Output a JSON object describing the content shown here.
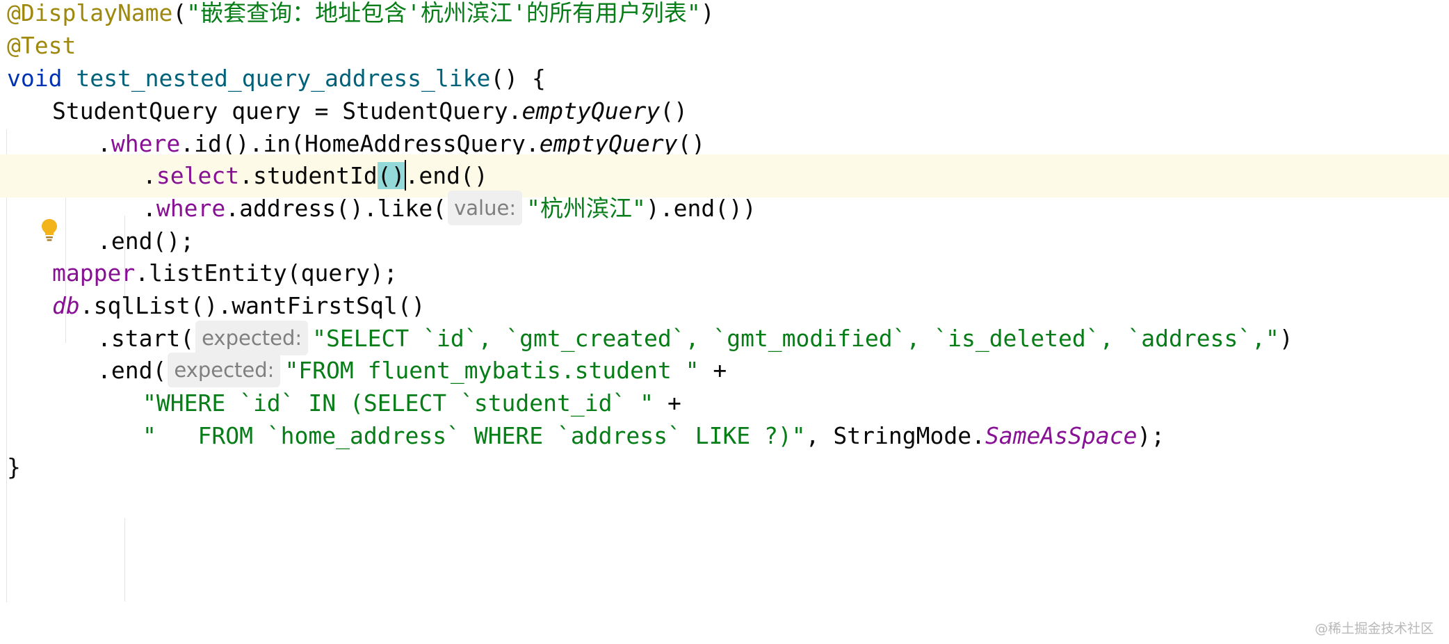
{
  "editor": {
    "lines": [
      {
        "tokens": [
          {
            "cls": "ann",
            "text": "@DisplayName"
          },
          {
            "cls": "plain",
            "text": "("
          },
          {
            "cls": "str",
            "text": "\"嵌套查询：地址包含'杭州滨江'的所有用户列表\""
          },
          {
            "cls": "plain",
            "text": ")"
          }
        ]
      },
      {
        "tokens": [
          {
            "cls": "ann",
            "text": "@Test"
          }
        ]
      },
      {
        "tokens": [
          {
            "cls": "kw",
            "text": "void "
          },
          {
            "cls": "fn",
            "text": "test_nested_query_address_like"
          },
          {
            "cls": "plain",
            "text": "() {"
          }
        ]
      },
      {
        "tokens": [
          {
            "cls": "plain",
            "text": "StudentQuery query = StudentQuery."
          },
          {
            "cls": "plain static-m",
            "text": "emptyQuery"
          },
          {
            "cls": "plain",
            "text": "()"
          }
        ]
      },
      {
        "tokens": [
          {
            "cls": "plain",
            "text": "."
          },
          {
            "cls": "fld",
            "text": "where"
          },
          {
            "cls": "plain",
            "text": ".id().in(HomeAddressQuery."
          },
          {
            "cls": "plain static-m",
            "text": "emptyQuery"
          },
          {
            "cls": "plain",
            "text": "()"
          }
        ]
      },
      {
        "tokens": [
          {
            "cls": "plain",
            "text": "."
          },
          {
            "cls": "fld",
            "text": "select"
          },
          {
            "cls": "plain",
            "text": ".studentId"
          },
          {
            "cls": "plain paren-hl",
            "text": "()"
          },
          {
            "cls": "caret",
            "text": ""
          },
          {
            "cls": "plain",
            "text": ".end()"
          }
        ]
      },
      {
        "tokens": [
          {
            "cls": "plain",
            "text": "."
          },
          {
            "cls": "fld",
            "text": "where"
          },
          {
            "cls": "plain",
            "text": ".address().like("
          },
          {
            "cls": "hint",
            "text": "value:"
          },
          {
            "cls": "str",
            "text": "\"杭州滨江\""
          },
          {
            "cls": "plain",
            "text": ").end())"
          }
        ]
      },
      {
        "tokens": [
          {
            "cls": "plain",
            "text": ".end();"
          }
        ]
      },
      {
        "tokens": [
          {
            "cls": "fld",
            "text": "mapper"
          },
          {
            "cls": "plain",
            "text": ".listEntity(query);"
          }
        ]
      },
      {
        "tokens": [
          {
            "cls": "stat",
            "text": "db"
          },
          {
            "cls": "plain",
            "text": ".sqlList().wantFirstSql()"
          }
        ]
      },
      {
        "tokens": [
          {
            "cls": "plain",
            "text": ".start("
          },
          {
            "cls": "hint",
            "text": "expected:"
          },
          {
            "cls": "str",
            "text": "\"SELECT `id`, `gmt_created`, `gmt_modified`, `is_deleted`, `address`,\""
          },
          {
            "cls": "plain",
            "text": ")"
          }
        ]
      },
      {
        "tokens": [
          {
            "cls": "plain",
            "text": ".end("
          },
          {
            "cls": "hint",
            "text": "expected:"
          },
          {
            "cls": "str",
            "text": "\"FROM fluent_mybatis.student \""
          },
          {
            "cls": "plain",
            "text": " +"
          }
        ]
      },
      {
        "tokens": [
          {
            "cls": "str",
            "text": "\"WHERE `id` IN (SELECT `student_id` \""
          },
          {
            "cls": "plain",
            "text": " +"
          }
        ]
      },
      {
        "tokens": [
          {
            "cls": "str",
            "text": "\"   FROM `home_address` WHERE `address` LIKE ?)\""
          },
          {
            "cls": "plain",
            "text": ", StringMode."
          },
          {
            "cls": "stat",
            "text": "SameAsSpace"
          },
          {
            "cls": "plain",
            "text": ");"
          }
        ]
      },
      {
        "tokens": [
          {
            "cls": "plain",
            "text": "}"
          }
        ]
      }
    ]
  },
  "icons": {
    "gutter": "lightbulb-icon",
    "bulb_color": "#f2b31b"
  },
  "watermark": "@稀土掘金技术社区"
}
